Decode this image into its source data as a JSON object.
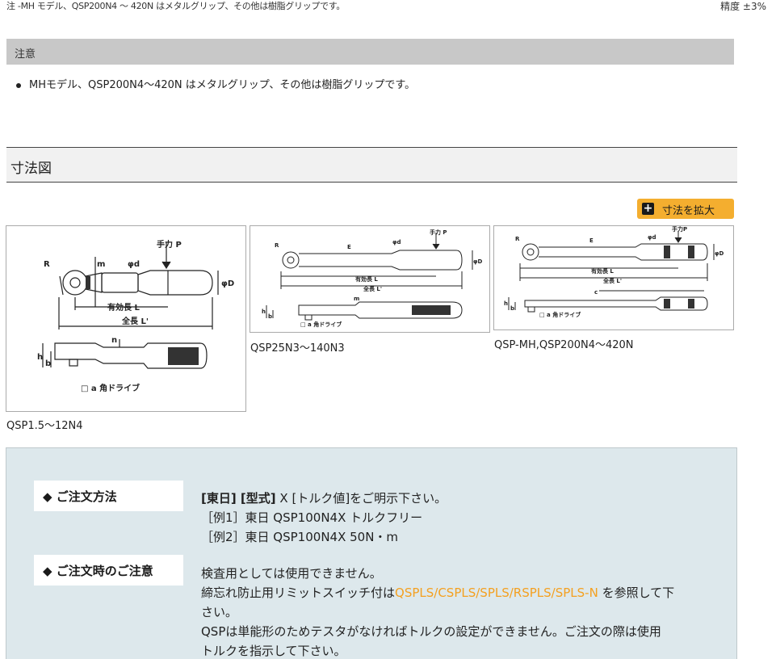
{
  "top": {
    "note": "注 -MH モデル、QSP200N4 〜 420N はメタルグリップ、その他は樹脂グリップです。",
    "accuracy": "精度 ±3%"
  },
  "notice": {
    "heading": "注意",
    "items": [
      "MHモデル、QSP200N4〜420N はメタルグリップ、その他は樹脂グリップです。"
    ]
  },
  "dimensions": {
    "heading": "寸法図",
    "enlarge_label": "寸法を拡大",
    "diagrams": [
      {
        "caption": "QSP1.5〜12N4",
        "labels": {
          "force": "手力 P",
          "r": "R",
          "m": "m",
          "d": "φd",
          "D": "φD",
          "eff_len": "有効長 L",
          "total_len": "全長 L'",
          "n": "n",
          "h": "h",
          "b": "b",
          "drive": "□ a 角ドライブ"
        }
      },
      {
        "caption": "QSP25N3〜140N3",
        "labels": {
          "force": "手力 P",
          "r": "R",
          "e": "E",
          "d": "φd",
          "D": "φD",
          "eff_len": "有効長 L",
          "total_len": "全長 L'",
          "m": "m",
          "h": "h",
          "b": "b",
          "drive": "□ a 角ドライブ"
        }
      },
      {
        "caption": "QSP-MH,QSP200N4〜420N",
        "labels": {
          "force": "手力P",
          "r": "R",
          "e": "E",
          "d": "φd",
          "D": "φD",
          "eff_len": "有効長 L",
          "total_len": "全長 L'",
          "c": "c",
          "h": "h",
          "b": "b",
          "drive": "□ a 角ドライブ"
        }
      }
    ]
  },
  "order": {
    "method_label": "◆ ご注文方法",
    "method_line1_bold": "[東日] [型式]",
    "method_line1_rest": " X [トルク値]をご明示下さい。",
    "example1": "［例1］東日 QSP100N4X トルクフリー",
    "example2": "［例2］東日 QSP100N4X 50N・m",
    "caution_label": "◆ ご注文時のご注意",
    "caution_line1": "検査用としては使用できません。",
    "caution_line2_pre": "締忘れ防止用リミットスイッチ付は",
    "caution_line2_link": "QSPLS/CSPLS/SPLS/RSPLS/SPLS-N",
    "caution_line2_post": " を参照して下",
    "caution_line3": "さい。",
    "caution_line4": "QSPは単能形のためテスタがなければトルクの設定ができません。ご注文の際は使用",
    "caution_line5": "トルクを指示して下さい。"
  }
}
